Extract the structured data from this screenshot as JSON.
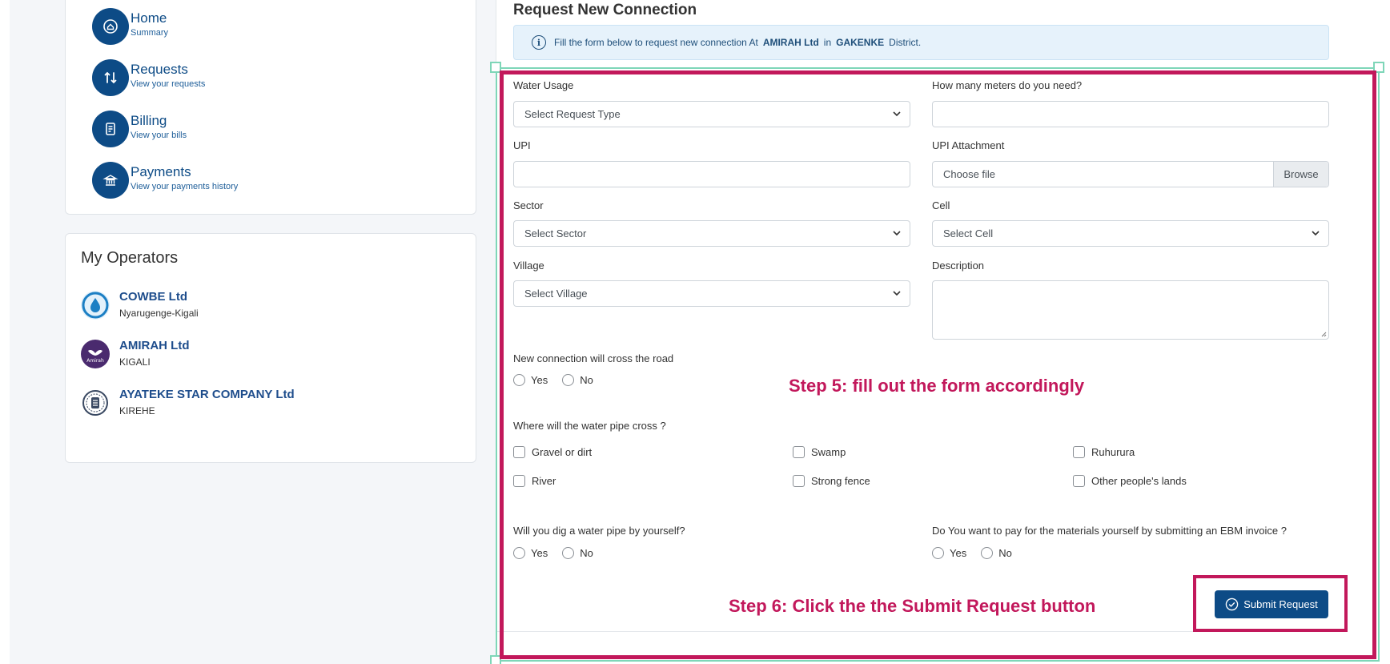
{
  "sidebar": {
    "nav": [
      {
        "title": "Home",
        "sub": "Summary",
        "icon": "home-icon"
      },
      {
        "title": "Requests",
        "sub": "View your requests",
        "icon": "requests-icon"
      },
      {
        "title": "Billing",
        "sub": "View your bills",
        "icon": "receipt-icon"
      },
      {
        "title": "Payments",
        "sub": "View your payments history",
        "icon": "bank-icon"
      }
    ],
    "operators_title": "My Operators",
    "operators": [
      {
        "name": "COWBE Ltd",
        "location": "Nyarugenge-Kigali",
        "logo": "water-drop-logo"
      },
      {
        "name": "AMIRAH Ltd",
        "location": "KIGALI",
        "logo": "amirah-logo",
        "logo_text": "Amirah"
      },
      {
        "name": "AYATEKE STAR COMPANY Ltd",
        "location": "KIREHE",
        "logo": "ayateke-seal-logo"
      }
    ]
  },
  "main": {
    "title": "Request New Connection",
    "info": {
      "prefix": "Fill the form below to request new connection At",
      "operator": "AMIRAH Ltd",
      "mid": "in",
      "district": "GAKENKE",
      "suffix": "District."
    }
  },
  "form": {
    "water_usage_label": "Water Usage",
    "water_usage_value": "Select Request Type",
    "meters_label": "How many meters do you need?",
    "meters_value": "",
    "upi_label": "UPI",
    "upi_value": "",
    "upi_attachment_label": "UPI Attachment",
    "upi_attachment_placeholder": "Choose file",
    "browse_label": "Browse",
    "sector_label": "Sector",
    "sector_value": "Select Sector",
    "cell_label": "Cell",
    "cell_value": "Select Cell",
    "village_label": "Village",
    "village_value": "Select Village",
    "description_label": "Description",
    "cross_road_label": "New connection will cross the road",
    "yes": "Yes",
    "no": "No",
    "pipe_cross_label": "Where will the water pipe cross ?",
    "pipe_cross_options": [
      "Gravel or dirt",
      "Swamp",
      "Ruhurura",
      "River",
      "Strong fence",
      "Other people's lands"
    ],
    "dig_label": "Will you dig a water pipe by yourself?",
    "ebm_label": "Do You want to pay for the materials yourself by submitting an EBM invoice ?",
    "submit_label": "Submit Request"
  },
  "annotations": {
    "step5": "Step 5: fill out the form accordingly",
    "step6": "Step 6: Click the the Submit Request button",
    "highlight_color": "#c2185b"
  },
  "colors": {
    "primary": "#0d4b86",
    "info_bg": "#e6f2fb",
    "accent": "#7ed6b8"
  }
}
